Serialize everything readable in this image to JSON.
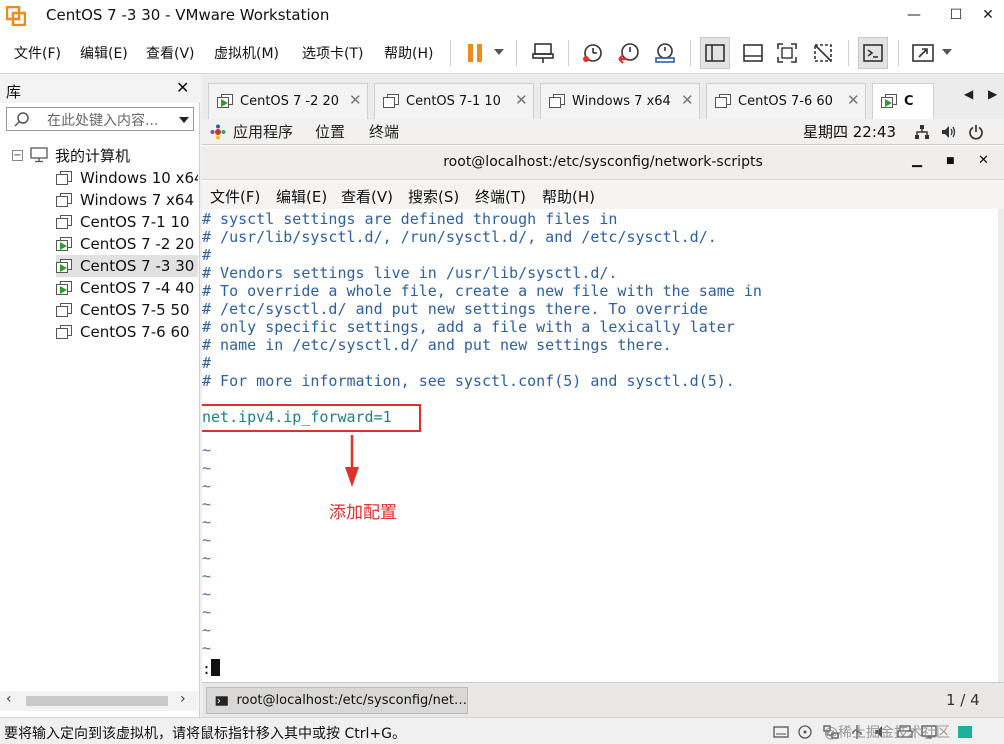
{
  "window": {
    "title": "CentOS 7 -3 30 - VMware Workstation",
    "minimize": "—",
    "maximize": "☐",
    "close": "✕"
  },
  "menu": [
    "文件(F)",
    "编辑(E)",
    "查看(V)",
    "虚拟机(M)",
    "选项卡(T)",
    "帮助(H)"
  ],
  "library": {
    "title": "库",
    "close": "✕",
    "search_placeholder": "在此处键入内容...",
    "root_label": "我的计算机",
    "items": [
      {
        "label": "Windows 10 x64",
        "running": false,
        "selected": false
      },
      {
        "label": "Windows 7 x64",
        "running": false,
        "selected": false
      },
      {
        "label": "CentOS 7-1  10",
        "running": false,
        "selected": false
      },
      {
        "label": "CentOS 7 -2 20",
        "running": true,
        "selected": false
      },
      {
        "label": "CentOS 7 -3 30",
        "running": true,
        "selected": true
      },
      {
        "label": "CentOS 7 -4 40",
        "running": true,
        "selected": false
      },
      {
        "label": "CentOS 7-5 50",
        "running": false,
        "selected": false
      },
      {
        "label": "CentOS 7-6  60",
        "running": false,
        "selected": false
      }
    ]
  },
  "tabs": [
    {
      "label": "CentOS 7 -2 20",
      "running": true
    },
    {
      "label": "CentOS 7-1  10",
      "running": false
    },
    {
      "label": "Windows 7 x64",
      "running": false
    },
    {
      "label": "CentOS 7-6  60",
      "running": false
    },
    {
      "label": "C",
      "running": true,
      "active": true
    }
  ],
  "gnome": {
    "menu": [
      "应用程序",
      "位置",
      "终端"
    ],
    "clock": "星期四 22:43"
  },
  "terminal": {
    "title": "root@localhost:/etc/sysconfig/network-scripts",
    "menu": [
      "文件(F)",
      "编辑(E)",
      "查看(V)",
      "搜索(S)",
      "终端(T)",
      "帮助(H)"
    ],
    "comment_lines": [
      "# sysctl settings are defined through files in",
      "# /usr/lib/sysctl.d/, /run/sysctl.d/, and /etc/sysctl.d/.",
      "#",
      "# Vendors settings live in /usr/lib/sysctl.d/.",
      "# To override a whole file, create a new file with the same in",
      "# /etc/sysctl.d/ and put new settings there. To override",
      "# only specific settings, add a file with a lexically later",
      "# name in /etc/sysctl.d/ and put new settings there.",
      "#",
      "# For more information, see sysctl.conf(5) and sysctl.d(5)."
    ],
    "setting_line": "net.ipv4.ip_forward=1",
    "tilde": "~",
    "prompt_char": ":"
  },
  "annotation": "添加配置",
  "guest_taskbar": {
    "item_label": "root@localhost:/etc/sysconfig/net…",
    "page": "1 / 4"
  },
  "status": {
    "text": "要将输入定向到该虚拟机，请将鼠标指针移入其中或按 Ctrl+G。",
    "watermark": "@稀土掘金技术社区"
  },
  "colors": {
    "accent_orange": "#f08a1c",
    "comment_blue": "#2d5fa3",
    "setting_teal": "#18838a",
    "annotation_red": "#e0302b"
  }
}
